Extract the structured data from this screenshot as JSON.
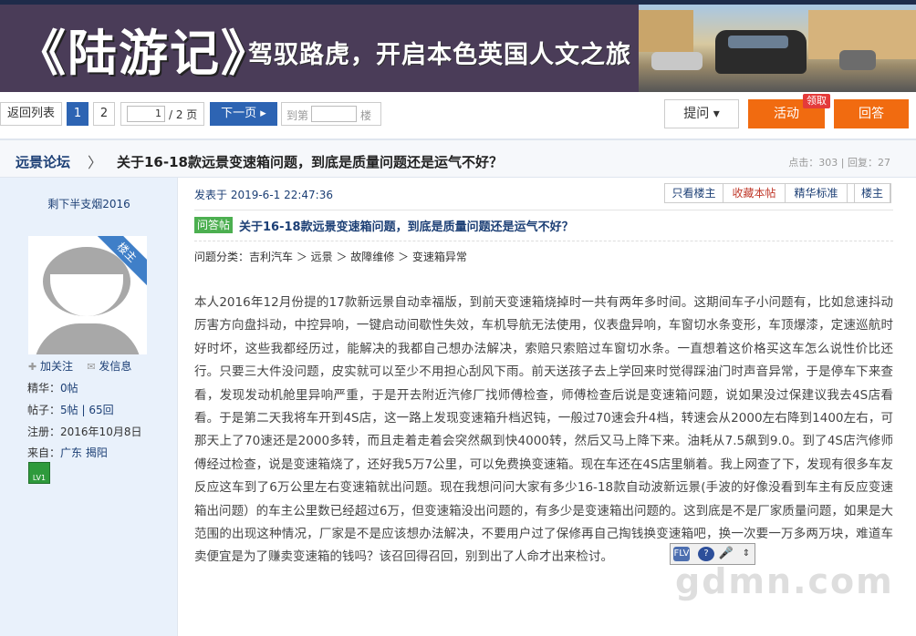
{
  "banner": {
    "logo": "《陆游记》",
    "slogan": "驾驭路虎，开启本色英国人文之旅"
  },
  "pagination": {
    "back_label": "返回列表",
    "pages": [
      "1",
      "2"
    ],
    "current_page_value": "1",
    "total_text": "/ 2 页",
    "next_label": "下一页 ▸",
    "jump_prefix": "到第",
    "jump_suffix": "楼",
    "ask_label": "提问 ▾",
    "activity_label": "活动",
    "activity_badge": "领取",
    "reply_label": "回答"
  },
  "thread": {
    "forum": "远景论坛",
    "separator": "〉",
    "title": "关于16-18款远景变速箱问题，到底是质量问题还是运气不好？",
    "stats": "点击：303 | 回复：27"
  },
  "author": {
    "name": "剩下半支烟2016",
    "corner_badge": "楼主",
    "follow_label": "加关注",
    "message_label": "发信息",
    "info": [
      {
        "label": "精华：",
        "value": "0帖"
      },
      {
        "label": "帖子：",
        "value": "5帖 | 65回"
      },
      {
        "label": "注册：",
        "value": "2016年10月8日"
      },
      {
        "label": "来自：",
        "value": "广东 揭阳"
      }
    ],
    "level": "LV1"
  },
  "post": {
    "published": "发表于 2019-6-1 22:47:36",
    "buttons": [
      "只看楼主",
      "收藏本帖",
      "精华标准",
      "楼主"
    ],
    "tag": "问答帖",
    "title": "关于16-18款远景变速箱问题，到底是质量问题还是运气不好？",
    "category": "问题分类：吉利汽车 ＞ 远景 ＞ 故障维修 ＞ 变速箱异常",
    "body": "本人2016年12月份提的17款新远景自动幸福版，到前天变速箱烧掉时一共有两年多时间。这期间车子小问题有，比如怠速抖动厉害方向盘抖动，中控异响，一键启动间歇性失效，车机导航无法使用，仪表盘异响，车窗切水条变形，车顶爆漆，定速巡航时好时坏，这些我都经历过，能解决的我都自己想办法解决，索赔只索赔过车窗切水条。一直想着这价格买这车怎么说性价比还行。只要三大件没问题，皮实就可以至少不用担心刮风下雨。前天送孩子去上学回来时觉得踩油门时声音异常，于是停车下来查看，发现发动机舱里异响严重，于是开去附近汽修厂找师傅检查，师傅检查后说是变速箱问题，说如果没过保建议我去4S店看看。于是第二天我将车开到4S店，这一路上发现变速箱升档迟钝，一般过70速会升4档，转速会从2000左右降到1400左右，可那天上了70速还是2000多转，而且走着走着会突然飙到快4000转，然后又马上降下来。油耗从7.5飙到9.0。到了4S店汽修师傅经过检查，说是变速箱烧了，还好我5万7公里，可以免费换变速箱。现在车还在4S店里躺着。我上网查了下，发现有很多车友反应这车到了6万公里左右变速箱就出问题。现在我想问问大家有多少16-18款自动波新远景(手波的好像没看到车主有反应变速箱出问题）的车主公里数已经超过6万，但变速箱没出问题的，有多少是变速箱出问题的。这到底是不是厂家质量问题，如果是大范围的出现这种情况，厂家是不是应该想办法解决，不要用户过了保修再自己掏钱换变速箱吧，换一次要一万多两万块，难道车卖便宜是为了赚卖变速箱的钱吗？该召回得召回，别到出了人命才出来检讨。"
  },
  "float_toolbar": {
    "icons": [
      "flv-icon",
      "help-icon",
      "microphone-icon",
      "scroll-icon"
    ]
  },
  "watermark": "gdmn.com",
  "colors": {
    "accent_blue": "#2d64b3",
    "accent_orange": "#f16b10",
    "link": "#1c3f75",
    "tag_green": "#4caf50"
  }
}
